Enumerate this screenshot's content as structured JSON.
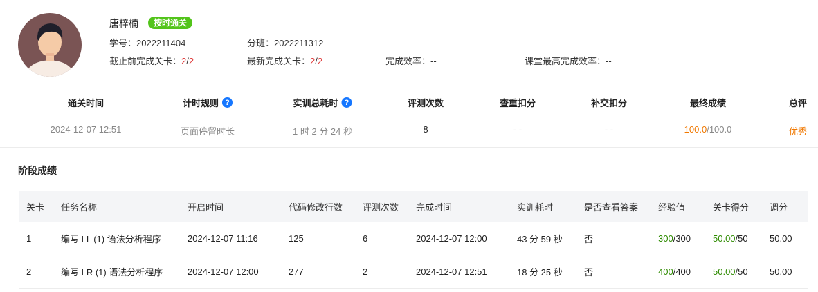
{
  "student": {
    "name": "唐梓楠",
    "badge": "按时通关",
    "student_id_label": "学号：",
    "student_id": "2022211404",
    "class_label": "分班：",
    "class": "2022211312",
    "before_deadline_label": "截止前完成关卡：",
    "before_deadline_done": "2",
    "before_deadline_total": "2",
    "latest_label": "最新完成关卡：",
    "latest_done": "2",
    "latest_total": "2",
    "efficiency_label": "完成效率：",
    "efficiency": "--",
    "class_best_label": "课堂最高完成效率：",
    "class_best": "--"
  },
  "summary": {
    "headers": {
      "pass_time": "通关时间",
      "timing_rule": "计时规则",
      "total_time": "实训总耗时",
      "eval_count": "评测次数",
      "dup_deduct": "查重扣分",
      "late_deduct": "补交扣分",
      "final_score": "最终成绩",
      "overall": "总评"
    },
    "values": {
      "pass_time": "2024-12-07 12:51",
      "timing_rule": "页面停留时长",
      "total_time": "1 时 2 分 24 秒",
      "eval_count": "8",
      "dup_deduct": "- -",
      "late_deduct": "- -",
      "final_score": "100.0",
      "final_total": "100.0",
      "overall": "优秀"
    }
  },
  "stage": {
    "title": "阶段成绩",
    "columns": [
      "关卡",
      "任务名称",
      "开启时间",
      "代码修改行数",
      "评测次数",
      "完成时间",
      "实训耗时",
      "是否查看答案",
      "经验值",
      "关卡得分",
      "调分"
    ],
    "rows": [
      {
        "level": "1",
        "task": "编写 LL (1) 语法分析程序",
        "open": "2024-12-07 11:16",
        "lines": "125",
        "evals": "6",
        "done": "2024-12-07 12:00",
        "duration": "43 分 59 秒",
        "answer": "否",
        "exp": "300",
        "exp_total": "300",
        "score": "50.00",
        "score_total": "50",
        "adjust": "50.00"
      },
      {
        "level": "2",
        "task": "编写 LR (1) 语法分析程序",
        "open": "2024-12-07 12:00",
        "lines": "277",
        "evals": "2",
        "done": "2024-12-07 12:51",
        "duration": "18 分 25 秒",
        "answer": "否",
        "exp": "400",
        "exp_total": "400",
        "score": "50.00",
        "score_total": "50",
        "adjust": "50.00"
      }
    ]
  },
  "colors": {
    "accent": "#1677ff",
    "badge": "#52c41a",
    "red": "#e03a3a",
    "orange": "#f07800",
    "green": "#2e8b00"
  }
}
